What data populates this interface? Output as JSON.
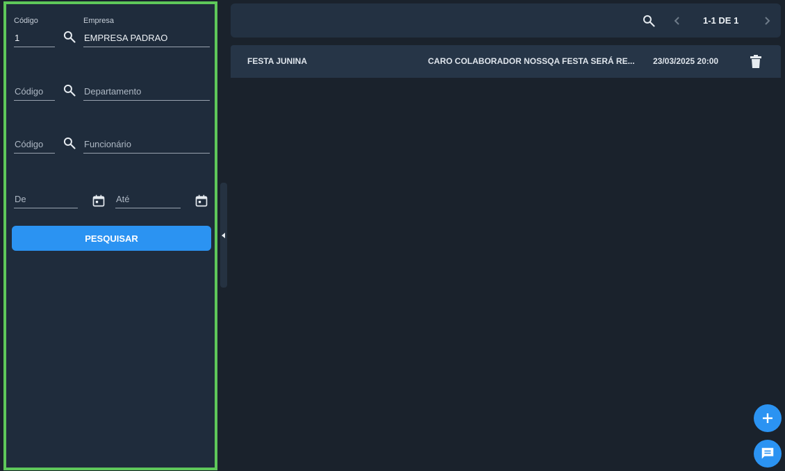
{
  "filters": {
    "empresa": {
      "code_label": "Código",
      "code_value": "1",
      "name_label": "Empresa",
      "name_value": "EMPRESA PADRAO"
    },
    "departamento": {
      "code_placeholder": "Código",
      "name_placeholder": "Departamento"
    },
    "funcionario": {
      "code_placeholder": "Código",
      "name_placeholder": "Funcionário"
    },
    "periodo": {
      "from_placeholder": "De",
      "to_placeholder": "Até"
    },
    "search_button_label": "PESQUISAR"
  },
  "toolbar": {
    "pagination_label": "1-1 DE 1"
  },
  "list": {
    "rows": [
      {
        "title": "FESTA JUNINA",
        "message": "CARO COLABORADOR NOSSQA FESTA SERÁ RE...",
        "datetime": "23/03/2025 20:00"
      }
    ]
  },
  "colors": {
    "accent": "#2b93f2",
    "panel_border": "#5ec85a",
    "background": "#1a222c"
  },
  "icons": {
    "search": "search-icon",
    "calendar": "calendar-icon",
    "delete": "trash-icon",
    "add": "plus-icon",
    "chat": "chat-icon"
  }
}
